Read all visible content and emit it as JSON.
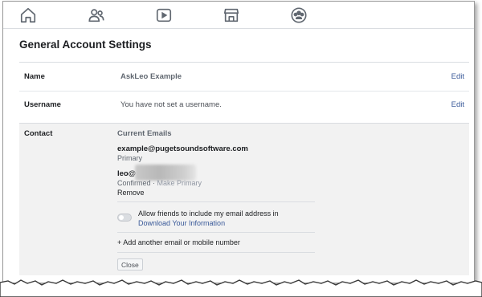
{
  "nav": {
    "icons": [
      "home-icon",
      "friends-icon",
      "watch-icon",
      "marketplace-icon",
      "groups-icon"
    ]
  },
  "settings": {
    "title": "General Account Settings"
  },
  "rows": {
    "name": {
      "label": "Name",
      "value": "AskLeo Example",
      "edit": "Edit"
    },
    "username": {
      "label": "Username",
      "value": "You have not set a username.",
      "edit": "Edit"
    }
  },
  "contact": {
    "label": "Contact",
    "current_emails_heading": "Current Emails",
    "email_primary": "example@pugetsoundsoftware.com",
    "primary_tag": "Primary",
    "email_secondary_prefix": "leo@",
    "confirmed": "Confirmed",
    "separator": "·",
    "make_primary": "Make Primary",
    "remove": "Remove",
    "allow_text": "Allow friends to include my email address in",
    "download_link": "Download Your Information",
    "toggle_on": false,
    "add_email": "+ Add another email or mobile number",
    "close_button": "Close"
  },
  "colors": {
    "link": "#385898",
    "panel_bg": "#f2f2f2",
    "divider": "#dadde1"
  }
}
